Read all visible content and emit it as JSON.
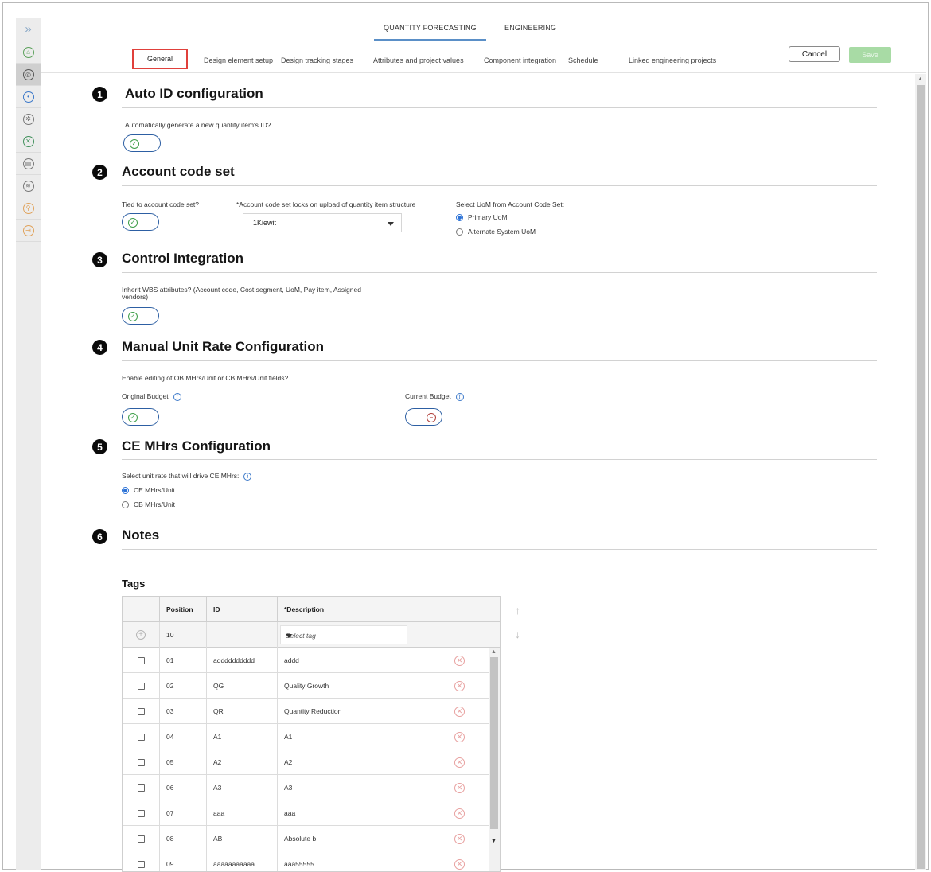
{
  "nav": {
    "tabs": [
      {
        "label": "QUANTITY FORECASTING"
      },
      {
        "label": "ENGINEERING"
      }
    ]
  },
  "subtabs": [
    {
      "label": "General"
    },
    {
      "label": "Design element setup"
    },
    {
      "label": "Design tracking stages"
    },
    {
      "label": "Attributes and project values"
    },
    {
      "label": "Component integration"
    },
    {
      "label": "Schedule"
    },
    {
      "label": "Linked engineering projects"
    }
  ],
  "actions": {
    "cancel": "Cancel",
    "save": "Save"
  },
  "sections": {
    "auto_id": {
      "number": "1",
      "title": "Auto ID configuration",
      "question": "Automatically generate a new quantity item's ID?"
    },
    "account_code": {
      "number": "2",
      "title": "Account code set",
      "tied_label": "Tied to account code set?",
      "lock_label": "*Account code set locks on upload of quantity item structure",
      "select_value": "1Kiewit",
      "uom_label": "Select UoM from Account Code Set:",
      "uom_options": [
        {
          "label": "Primary UoM"
        },
        {
          "label": "Alternate System UoM"
        }
      ]
    },
    "control": {
      "number": "3",
      "title": "Control Integration",
      "question_line1": "Inherit WBS attributes? (Account code, Cost segment, UoM, Pay item, Assigned",
      "question_line2": "vendors)"
    },
    "manual_rate": {
      "number": "4",
      "title": "Manual Unit Rate Configuration",
      "question": "Enable editing of OB MHrs/Unit or CB MHrs/Unit fields?",
      "original_label": "Original Budget",
      "current_label": "Current Budget"
    },
    "ce_mhrs": {
      "number": "5",
      "title": "CE MHrs Configuration",
      "question": "Select unit rate that will drive CE MHrs:",
      "options": [
        {
          "label": "CE MHrs/Unit"
        },
        {
          "label": "CB MHrs/Unit"
        }
      ]
    },
    "notes": {
      "number": "6",
      "title": "Notes"
    }
  },
  "tags": {
    "title": "Tags",
    "headers": {
      "position": "Position",
      "id": "ID",
      "description": "*Description"
    },
    "new_row": {
      "position": "10",
      "placeholder": "Select tag"
    },
    "rows": [
      {
        "position": "01",
        "id": "adddddddddd",
        "description": "addd"
      },
      {
        "position": "02",
        "id": "QG",
        "description": "Quality Growth"
      },
      {
        "position": "03",
        "id": "QR",
        "description": "Quantity Reduction"
      },
      {
        "position": "04",
        "id": "A1",
        "description": "A1"
      },
      {
        "position": "05",
        "id": "A2",
        "description": "A2"
      },
      {
        "position": "06",
        "id": "A3",
        "description": "A3"
      },
      {
        "position": "07",
        "id": "aaa",
        "description": "aaa"
      },
      {
        "position": "08",
        "id": "AB",
        "description": "Absolute b"
      },
      {
        "position": "09",
        "id": "aaaaaaaaaaa",
        "description": "aaa55555"
      }
    ]
  }
}
